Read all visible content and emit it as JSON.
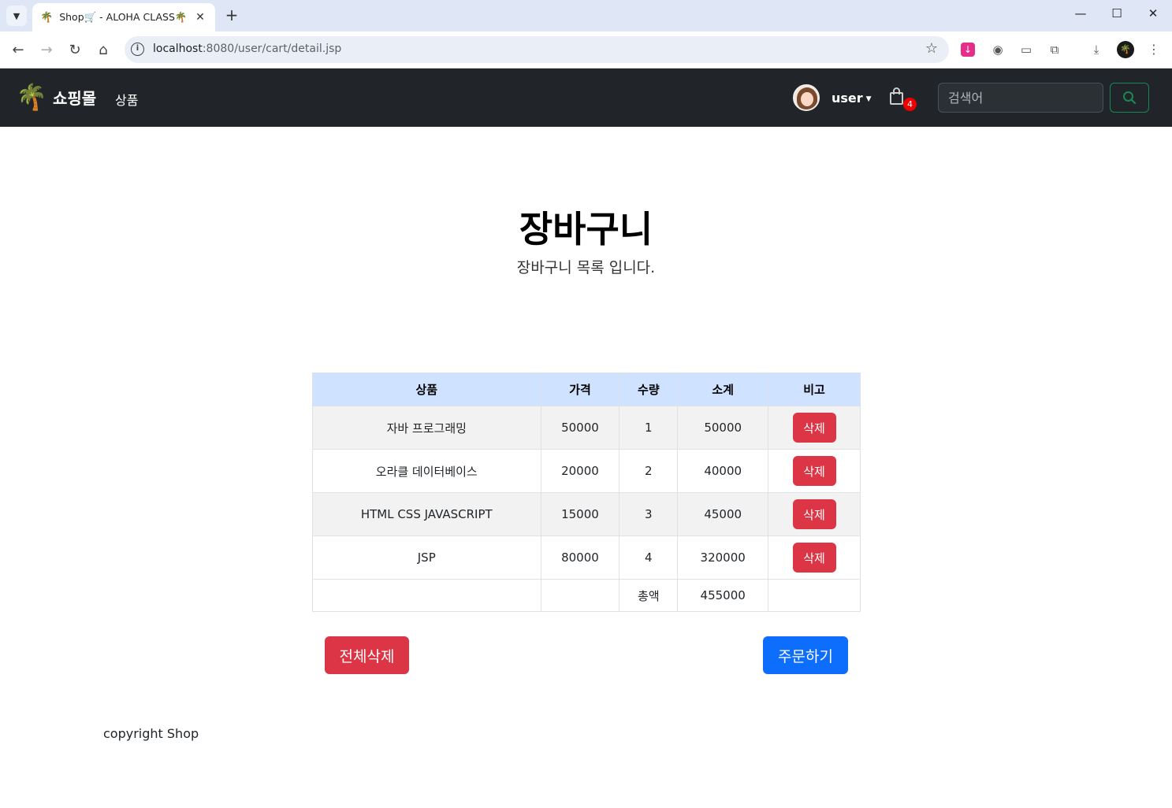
{
  "browser": {
    "tab_title": "Shop🛒 - ALOHA CLASS🌴",
    "tab_favicon": "🌴",
    "url_host": "localhost",
    "url_rest": ":8080/user/cart/detail.jsp"
  },
  "navbar": {
    "brand": "쇼핑몰",
    "brand_icon": "🌴",
    "product_link": "상품",
    "user_name": "user",
    "cart_count": "4",
    "search_placeholder": "검색어"
  },
  "page": {
    "title": "장바구니",
    "subtitle": "장바구니 목록 입니다."
  },
  "cart": {
    "headers": [
      "상품",
      "가격",
      "수량",
      "소계",
      "비고"
    ],
    "rows": [
      {
        "product": "자바 프로그래밍",
        "price": "50000",
        "qty": "1",
        "subtotal": "50000",
        "action": "삭제"
      },
      {
        "product": "오라클 데이터베이스",
        "price": "20000",
        "qty": "2",
        "subtotal": "40000",
        "action": "삭제"
      },
      {
        "product": "HTML CSS JAVASCRIPT",
        "price": "15000",
        "qty": "3",
        "subtotal": "45000",
        "action": "삭제"
      },
      {
        "product": "JSP",
        "price": "80000",
        "qty": "4",
        "subtotal": "320000",
        "action": "삭제"
      }
    ],
    "total_label": "총액",
    "total_value": "455000"
  },
  "actions": {
    "delete_all": "전체삭제",
    "order": "주문하기"
  },
  "footer": {
    "text": "copyright Shop"
  },
  "colors": {
    "navbar_bg": "#212529",
    "danger": "#dc3545",
    "primary": "#0d6efd",
    "table_header": "#cfe2ff",
    "search_btn_border": "#198754"
  }
}
